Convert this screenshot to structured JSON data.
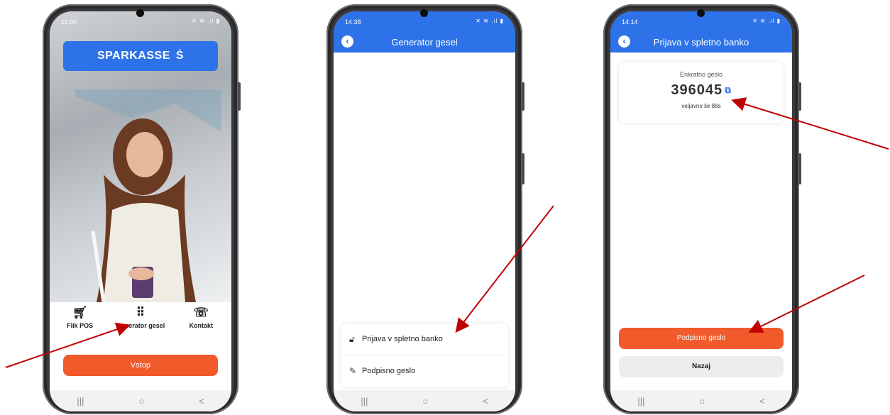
{
  "colors": {
    "brand_blue": "#2d72e8",
    "accent_orange": "#f15a2b",
    "arrow_red": "#c00000"
  },
  "phone1": {
    "status_time": "11:00",
    "status_icons": "✕ ≋ .ıl ▮",
    "brand": "SPARKASSE",
    "quick_actions": [
      {
        "label": "Flik POS",
        "icon": "cart-icon"
      },
      {
        "label": "Generator gesel",
        "icon": "keypad-icon"
      },
      {
        "label": "Kontakt",
        "icon": "phone-icon"
      }
    ],
    "enter_button": "Vstop"
  },
  "phone2": {
    "status_time": "14:38",
    "status_icons": "✕ ≋ .ıl ▮",
    "title": "Generator gesel",
    "menu": [
      {
        "label": "Prijava v spletno banko",
        "icon": "lock-icon"
      },
      {
        "label": "Podpisno geslo",
        "icon": "pencil-icon"
      }
    ]
  },
  "phone3": {
    "status_time": "14:14",
    "status_icons": "✕ ≋ .ıl ▮",
    "title": "Prijava v spletno banko",
    "otp_label": "Enkratno geslo",
    "otp_code": "396045",
    "validity": "veljavno še 88s",
    "primary_button": "Podpisno geslo",
    "secondary_button": "Nazaj"
  },
  "system_nav": {
    "recent": "|||",
    "home": "○",
    "back": "<"
  }
}
